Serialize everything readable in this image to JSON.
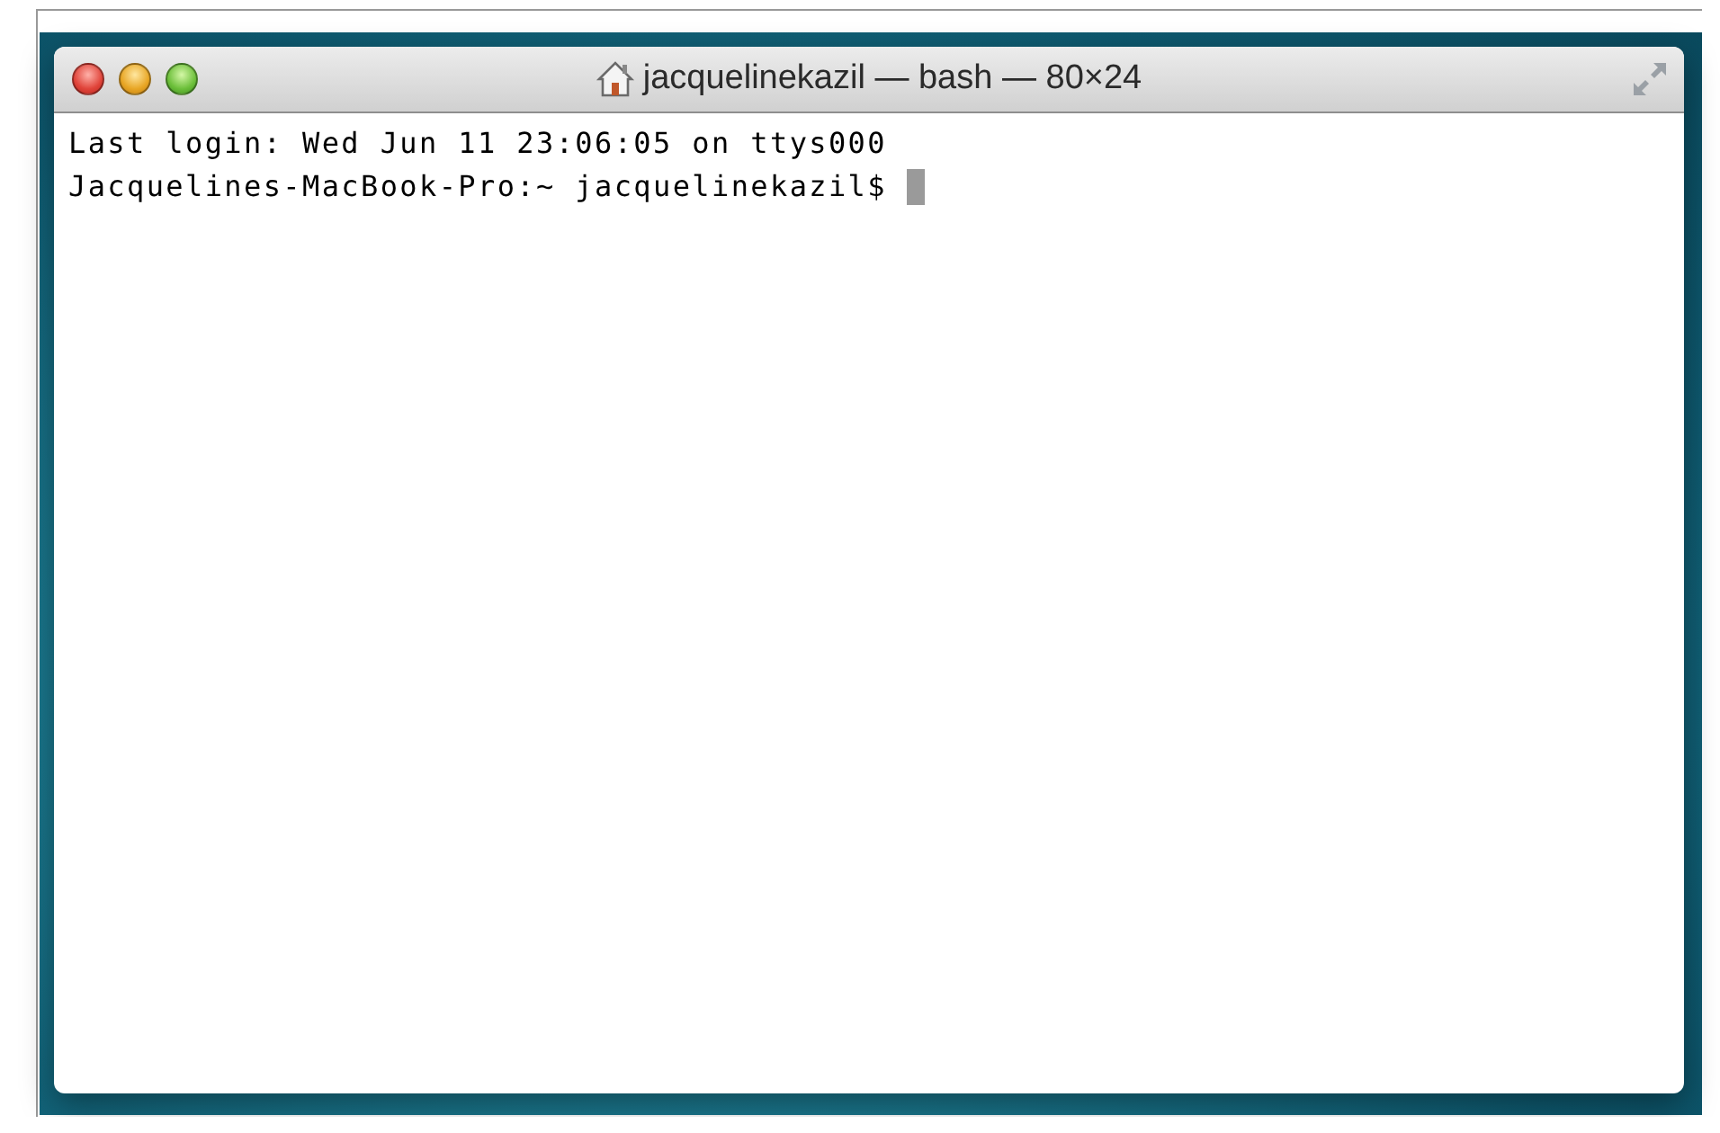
{
  "window": {
    "title": "jacquelinekazil — bash — 80×24"
  },
  "terminal": {
    "lines": [
      "Last login: Wed Jun 11 23:06:05 on ttys000",
      "Jacquelines-MacBook-Pro:~ jacquelinekazil$ "
    ]
  }
}
